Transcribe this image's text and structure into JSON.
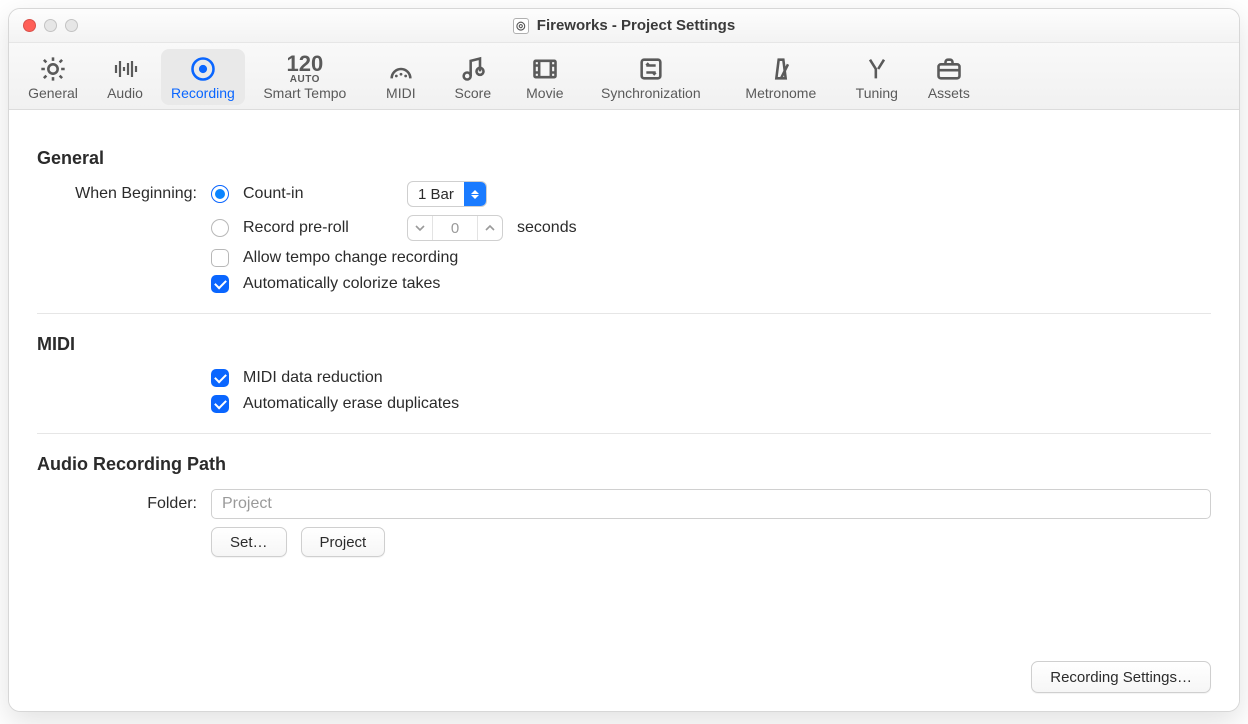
{
  "window": {
    "title": "Fireworks - Project Settings"
  },
  "toolbar": {
    "items": [
      {
        "id": "general",
        "label": "General"
      },
      {
        "id": "audio",
        "label": "Audio"
      },
      {
        "id": "recording",
        "label": "Recording",
        "active": true
      },
      {
        "id": "smart-tempo",
        "label": "Smart Tempo",
        "tempo_big": "120",
        "tempo_small": "AUTO"
      },
      {
        "id": "midi",
        "label": "MIDI"
      },
      {
        "id": "score",
        "label": "Score"
      },
      {
        "id": "movie",
        "label": "Movie"
      },
      {
        "id": "synchronization",
        "label": "Synchronization"
      },
      {
        "id": "metronome",
        "label": "Metronome"
      },
      {
        "id": "tuning",
        "label": "Tuning"
      },
      {
        "id": "assets",
        "label": "Assets"
      }
    ]
  },
  "sections": {
    "general": {
      "title": "General",
      "when_beginning_label": "When Beginning:",
      "count_in_label": "Count-in",
      "count_in_selected": true,
      "count_in_value": "1 Bar",
      "preroll_label": "Record pre-roll",
      "preroll_selected": false,
      "preroll_value": "0",
      "preroll_unit": "seconds",
      "allow_tempo_change_label": "Allow tempo change recording",
      "allow_tempo_change_checked": false,
      "auto_colorize_label": "Automatically colorize takes",
      "auto_colorize_checked": true
    },
    "midi": {
      "title": "MIDI",
      "data_reduction_label": "MIDI data reduction",
      "data_reduction_checked": true,
      "auto_erase_dup_label": "Automatically erase duplicates",
      "auto_erase_dup_checked": true
    },
    "path": {
      "title": "Audio Recording Path",
      "folder_label": "Folder:",
      "folder_value": "Project",
      "set_button": "Set…",
      "project_button": "Project"
    }
  },
  "footer": {
    "recording_settings_button": "Recording Settings…"
  }
}
